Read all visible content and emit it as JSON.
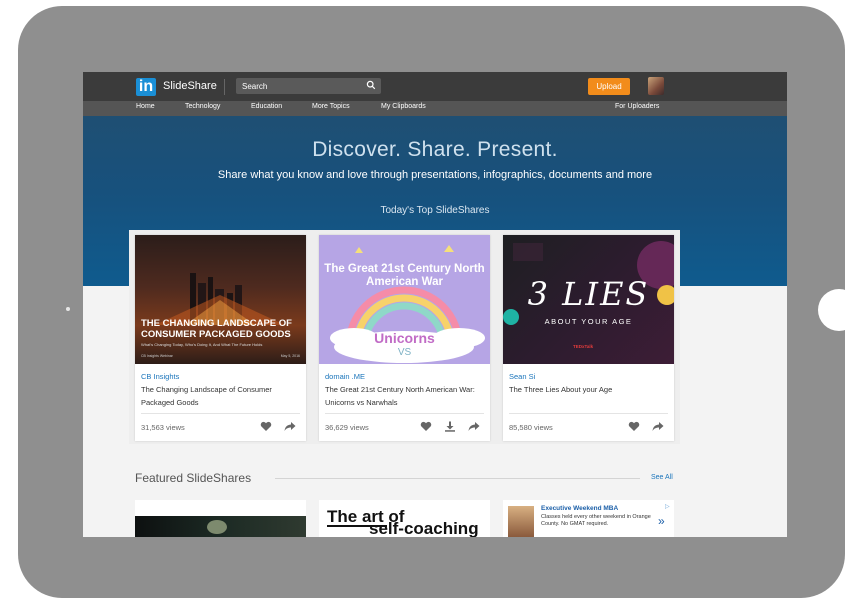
{
  "header": {
    "logo_in": "in",
    "brand": "SlideShare",
    "search_placeholder": "Search",
    "upload_label": "Upload"
  },
  "nav": {
    "items": [
      "Home",
      "Technology",
      "Education",
      "More Topics",
      "My Clipboards"
    ],
    "right_item": "For Uploaders"
  },
  "hero": {
    "title": "Discover. Share. Present.",
    "subtitle": "Share what you know and love through presentations, infographics, documents and more",
    "section_title": "Today's Top SlideShares"
  },
  "cards": [
    {
      "author": "CB Insights",
      "title": "The Changing Landscape of Consumer Packaged Goods",
      "views": "31,563 views",
      "thumb_title": "THE CHANGING LANDSCAPE OF CONSUMER PACKAGED GOODS",
      "thumb_subtitle": "What's Changing Today, Who's Doing It, And What The Future Holds",
      "thumb_footer_left": "CB Insights Webinar",
      "thumb_footer_right": "May 5, 2016"
    },
    {
      "author": "domain .ME",
      "title": "The Great 21st Century North American War: Unicorns vs Narwhals",
      "views": "36,629 views",
      "thumb_title": "The Great 21st Century North American War",
      "thumb_word": "Unicorns",
      "thumb_vs": "VS"
    },
    {
      "author": "Sean Si",
      "title": "The Three Lies About your Age",
      "views": "85,580 views",
      "thumb_title": "3 LIES",
      "thumb_subtitle": "ABOUT YOUR AGE",
      "thumb_tag": "TEDxTalk"
    }
  ],
  "featured": {
    "title": "Featured SlideShares",
    "see_all": "See All",
    "card2_line1": "The art of",
    "card2_line2": "self-coaching",
    "ad": {
      "title": "Executive Weekend MBA",
      "description": "Classes held every other weekend in Orange County. No GMAT required.",
      "arrow": "»",
      "info": "▷"
    }
  },
  "colors": {
    "accent_orange": "#f28c1b",
    "link_blue": "#1b75bb",
    "linkedin_blue": "#1a8fd6",
    "hero_blue": "#17517d",
    "topbar": "#3b3b3b"
  }
}
